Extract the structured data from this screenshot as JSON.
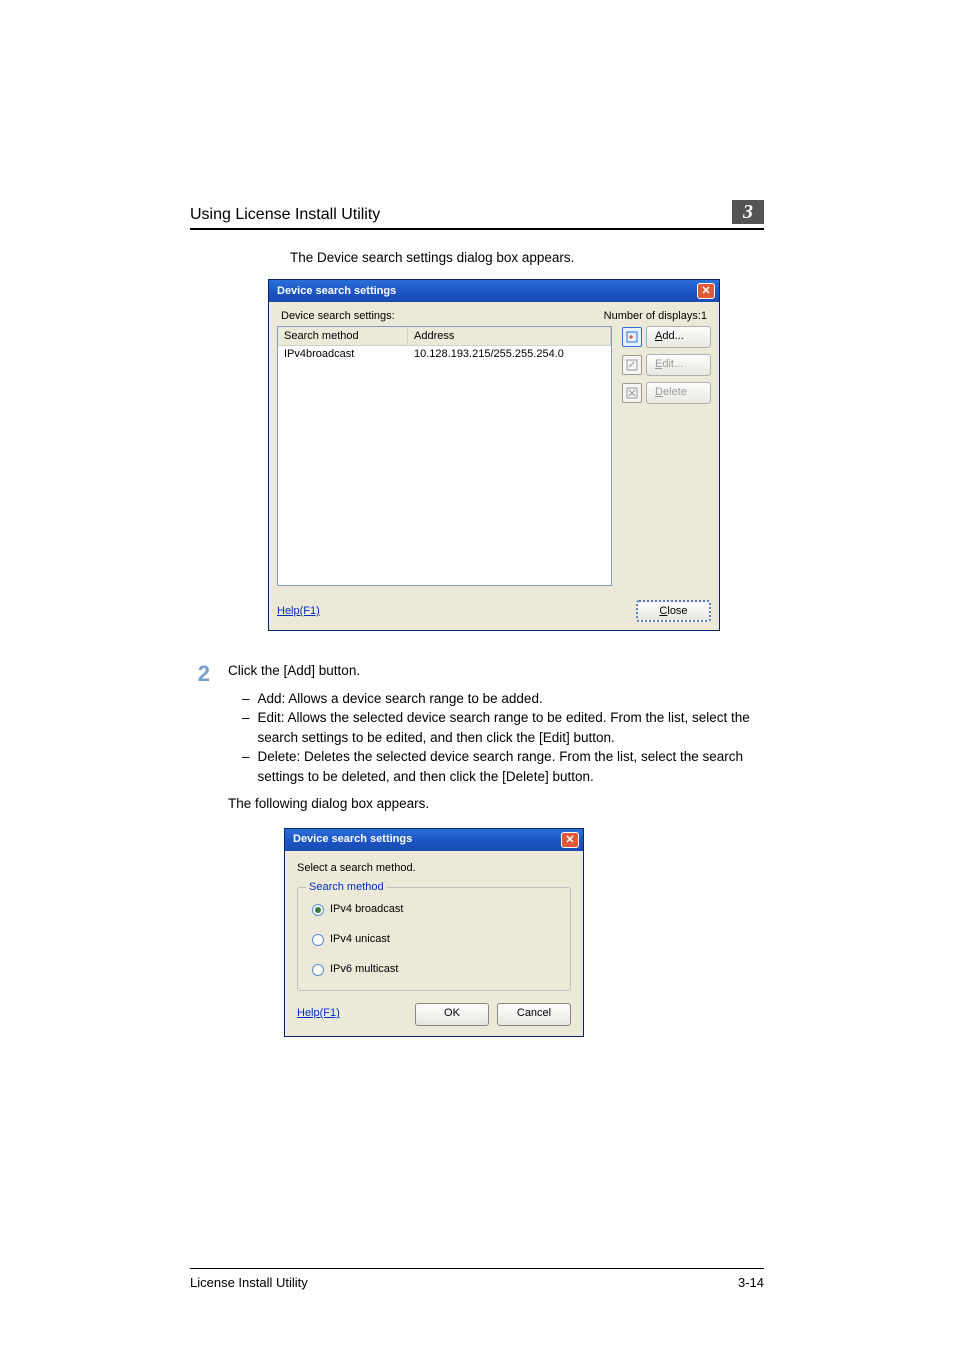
{
  "header": {
    "title": "Using License Install Utility",
    "chapter": "3"
  },
  "intro": "The Device search settings dialog box appears.",
  "dialog1": {
    "title": "Device search settings",
    "label_settings": "Device search settings:",
    "label_count": "Number of displays:1",
    "col1": "Search method",
    "col2": "Address",
    "row_method": "IPv4broadcast",
    "row_address": "10.128.193.215/255.255.254.0",
    "btn_add": "Add...",
    "btn_edit": "Edit...",
    "btn_delete": "Delete",
    "help": "Help(F1)",
    "close": "Close"
  },
  "step": {
    "num": "2",
    "instr": "Click the [Add] button.",
    "items": [
      "Add: Allows a device search range to be added.",
      "Edit: Allows the selected device search range to be edited. From the list, select the search settings to be edited, and then click the [Edit] button.",
      "Delete: Deletes the selected device search range. From the list, select the search settings to be deleted, and then click the [Delete] button."
    ],
    "followup": "The following dialog box appears."
  },
  "dialog2": {
    "title": "Device search settings",
    "msg": "Select a search method.",
    "legend": "Search method",
    "opt1": "IPv4 broadcast",
    "opt2": "IPv4 unicast",
    "opt3": "IPv6 multicast",
    "help": "Help(F1)",
    "ok": "OK",
    "cancel": "Cancel"
  },
  "footer": {
    "left": "License Install Utility",
    "right": "3-14"
  }
}
